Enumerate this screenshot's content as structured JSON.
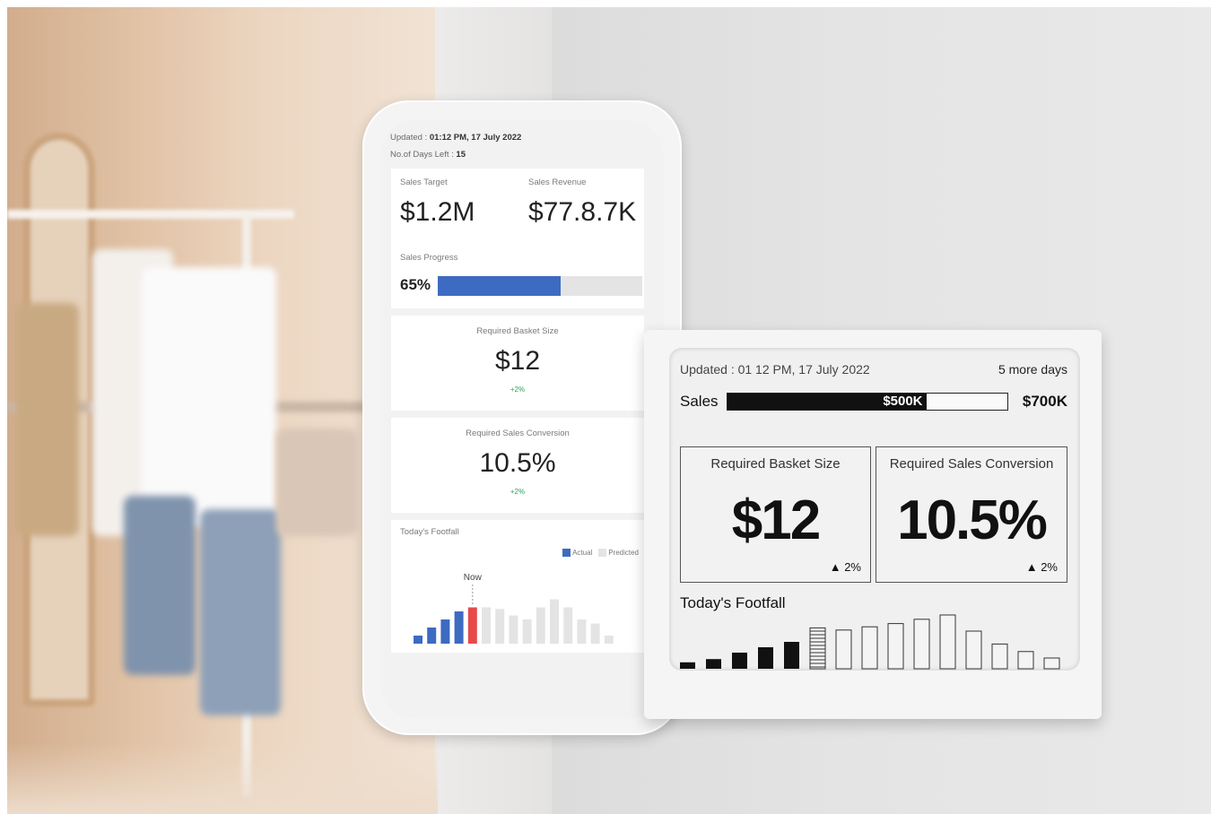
{
  "phone": {
    "updated_label": "Updated : ",
    "updated_value": "01:12 PM, 17 July 2022",
    "days_left_label": "No.of Days Left : ",
    "days_left_value": "15",
    "sales_target_label": "Sales Target",
    "sales_target_value": "$1.2M",
    "sales_revenue_label": "Sales Revenue",
    "sales_revenue_value": "$77.8.7K",
    "sales_progress_label": "Sales Progress",
    "sales_progress_value": "65%",
    "sales_progress_fraction": 0.6,
    "basket_label": "Required Basket Size",
    "basket_value": "$12",
    "basket_change": "+2%",
    "conversion_label": "Required Sales Conversion",
    "conversion_value": "10.5%",
    "conversion_change": "+2%",
    "footfall_title": "Today's Footfall",
    "legend_actual": "Actual",
    "legend_predicted": "Predicted",
    "now_label": "Now"
  },
  "tag": {
    "updated": "Updated : 01 12 PM, 17 July 2022",
    "days": "5 more days",
    "sales_label": "Sales",
    "sales_current": "$500K",
    "sales_target": "$700K",
    "sales_fraction": 0.71,
    "basket_label": "Required Basket Size",
    "basket_value": "$12",
    "basket_change": "2%",
    "conversion_label": "Required Sales Conversion",
    "conversion_value": "10.5%",
    "conversion_change": "2%",
    "footfall_title": "Today's Footfall"
  },
  "chart_data": [
    {
      "type": "bar",
      "title": "Today's Footfall",
      "series": [
        {
          "name": "Actual",
          "values": [
            1,
            2,
            3,
            4,
            4.5,
            null,
            null,
            null,
            null,
            null,
            null,
            null,
            null,
            null,
            null
          ]
        },
        {
          "name": "Predicted",
          "values": [
            null,
            null,
            null,
            null,
            null,
            4.5,
            4.3,
            3.5,
            3,
            4.5,
            5.5,
            4.5,
            3,
            2.5,
            1
          ]
        }
      ],
      "annotation": "Now",
      "colors": {
        "actual": "#3d6bc2",
        "now": "#e84a4a",
        "predicted": "#e4e4e4"
      }
    },
    {
      "type": "bar",
      "title": "Today's Footfall",
      "series": [
        {
          "name": "Actual",
          "values": [
            0.6,
            0.9,
            1.5,
            2.0,
            2.5,
            null,
            null,
            null,
            null,
            null,
            null,
            null,
            null,
            null,
            null
          ]
        },
        {
          "name": "Predicted",
          "values": [
            null,
            null,
            null,
            null,
            null,
            3.8,
            3.6,
            3.9,
            4.2,
            4.6,
            5.0,
            3.5,
            2.3,
            1.6,
            1.0
          ]
        }
      ],
      "style": "e-paper monochrome; current hour hatched"
    }
  ]
}
